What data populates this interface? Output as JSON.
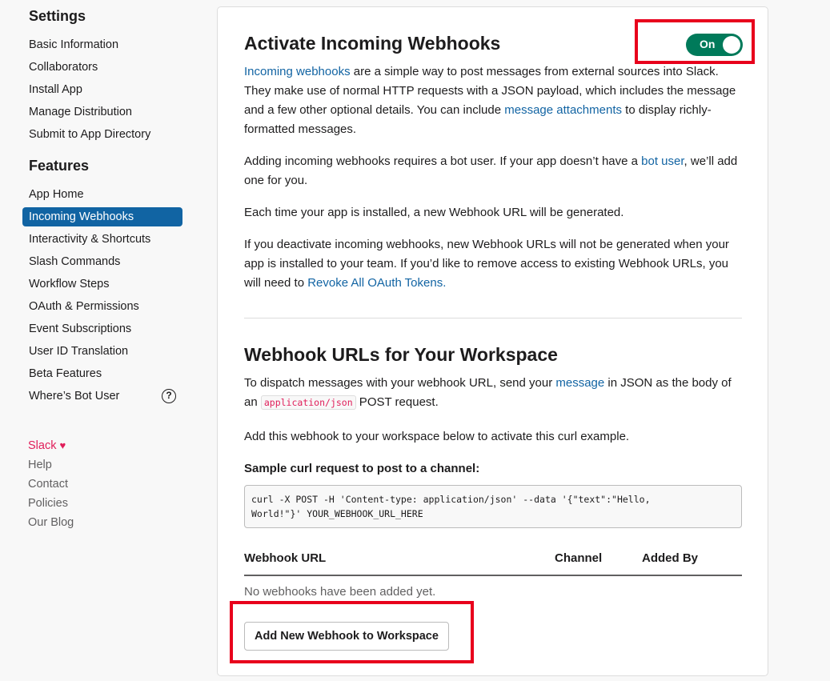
{
  "sidebar": {
    "settings_heading": "Settings",
    "settings_items": [
      "Basic Information",
      "Collaborators",
      "Install App",
      "Manage Distribution",
      "Submit to App Directory"
    ],
    "features_heading": "Features",
    "features_items": [
      "App Home",
      "Incoming Webhooks",
      "Interactivity & Shortcuts",
      "Slash Commands",
      "Workflow Steps",
      "OAuth & Permissions",
      "Event Subscriptions",
      "User ID Translation",
      "Beta Features",
      "Where’s Bot User"
    ],
    "active_item": "Incoming Webhooks",
    "help_icon": "?",
    "footer": {
      "slack": "Slack",
      "heart": "♥",
      "links": [
        "Help",
        "Contact",
        "Policies",
        "Our Blog"
      ]
    }
  },
  "activate": {
    "title": "Activate Incoming Webhooks",
    "toggle_label": "On",
    "toggle_state": true,
    "p1": {
      "link1": "Incoming webhooks",
      "text1": " are a simple way to post messages from external sources into Slack. They make use of normal HTTP requests with a JSON payload, which includes the message and a few other optional details. You can include ",
      "link2": "message attachments",
      "text2": " to display richly-formatted messages."
    },
    "p2": {
      "text1": "Adding incoming webhooks requires a bot user. If your app doesn’t have a ",
      "link": "bot user",
      "text2": ", we’ll add one for you."
    },
    "p3": "Each time your app is installed, a new Webhook URL will be generated.",
    "p4": {
      "text1": "If you deactivate incoming webhooks, new Webhook URLs will not be generated when your app is installed to your team. If you’d like to remove access to existing Webhook URLs, you will need to ",
      "link": "Revoke All OAuth Tokens."
    }
  },
  "workspace": {
    "title": "Webhook URLs for Your Workspace",
    "p1": {
      "text1": "To dispatch messages with your webhook URL, send your ",
      "link": "message",
      "text2": " in JSON as the body of an ",
      "code": "application/json",
      "text3": " POST request."
    },
    "p2": "Add this webhook to your workspace below to activate this curl example.",
    "sample_heading": "Sample curl request to post to a channel:",
    "sample_code": "curl -X POST -H 'Content-type: application/json' --data '{\"text\":\"Hello,\nWorld!\"}' YOUR_WEBHOOK_URL_HERE",
    "table": {
      "col_url": "Webhook URL",
      "col_channel": "Channel",
      "col_added_by": "Added By",
      "empty": "No webhooks have been added yet."
    },
    "add_button": "Add New Webhook to Workspace"
  },
  "colors": {
    "accent": "#1264a3",
    "active_bg": "#1164a3",
    "toggle_on": "#007a5a",
    "highlight": "#e8001c",
    "slack_pink": "#e01e5a"
  }
}
